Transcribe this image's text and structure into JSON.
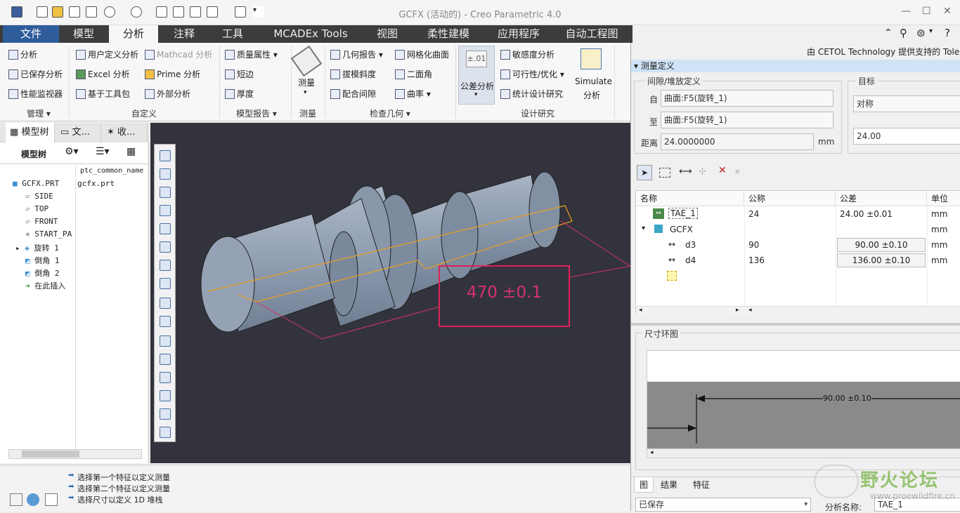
{
  "window": {
    "title": "GCFX (活动的) - Creo Parametric 4.0"
  },
  "tabs": [
    "文件",
    "模型",
    "分析",
    "注释",
    "工具",
    "MCADEx Tools",
    "视图",
    "柔性建模",
    "应用程序",
    "自动工程图"
  ],
  "ribbon": {
    "manage": {
      "items": [
        "分析",
        "已保存分析",
        "性能监视器"
      ],
      "group": "管理"
    },
    "custom": {
      "items": [
        "用户定义分析",
        "Mathcad 分析",
        "Excel 分析",
        "Prime 分析",
        "基于工具包",
        "外部分析"
      ],
      "group": "自定义"
    },
    "model_report": {
      "items": [
        "质量属性",
        "短边",
        "厚度"
      ],
      "group": "模型报告"
    },
    "measure": {
      "label": "测量",
      "group": "测量"
    },
    "inspect": {
      "items": [
        "几何报告",
        "网格化曲面",
        "拔模斜度",
        "二面角",
        "配合间隙",
        "曲率"
      ],
      "group": "检查几何"
    },
    "design": {
      "tol_icon": "±.01",
      "tol_label": "公差分析",
      "items": [
        "敏感度分析",
        "可行性/优化",
        "统计设计研究"
      ],
      "simulate": [
        "Simulate",
        "分析"
      ],
      "group": "设计研究"
    }
  },
  "sidebar": {
    "tabs": [
      "模型树",
      "文...",
      "收..."
    ],
    "toolbar_label": "模型树",
    "column": "ptc_common_name",
    "items": [
      {
        "label": "GCFX.PRT",
        "value": "gcfx.prt"
      },
      {
        "label": "SIDE"
      },
      {
        "label": "TOP"
      },
      {
        "label": "FRONT"
      },
      {
        "label": "START_PA"
      },
      {
        "label": "旋转 1"
      },
      {
        "label": "倒角 1"
      },
      {
        "label": "倒角 2"
      },
      {
        "label": "在此插入"
      }
    ]
  },
  "viewport": {
    "dimension_text": "470 ±0.1"
  },
  "status": {
    "messages": [
      "选择第一个特征以定义测量",
      "选择第二个特征以定义测量",
      "选择尺寸以定义 1D 堆栈"
    ]
  },
  "panel": {
    "header": "由 CETOL Technology 提供支持的 Toler",
    "section": "测量定义",
    "gap_group": "间隙/堆放定义",
    "from_label": "自",
    "from_value": "曲面:F5(旋转_1)",
    "to_label": "至",
    "to_value": "曲面:F5(旋转_1)",
    "dist_label": "距离",
    "dist_value": "24.0000000",
    "dist_unit": "mm",
    "target_group": "目标",
    "target_select": "对称",
    "target_value": "24.00",
    "table": {
      "headers": [
        "名称",
        "公称",
        "公差",
        "单位"
      ],
      "rows": [
        {
          "name": "TAE_1",
          "nominal": "24",
          "tol": "24.00 ±0.01",
          "unit": "mm"
        },
        {
          "name": "GCFX",
          "nominal": "",
          "tol": "",
          "unit": "mm"
        },
        {
          "name": "d3",
          "nominal": "90",
          "tol": "90.00 ±0.10",
          "unit": "mm"
        },
        {
          "name": "d4",
          "nominal": "136",
          "tol": "136.00 ±0.10",
          "unit": "mm"
        }
      ]
    },
    "loop_title": "尺寸环图",
    "loop_dim": "90.00 ±0.10",
    "bottom_tabs": [
      "图",
      "结果",
      "特征"
    ],
    "saved_select": "已保存",
    "analysis_name_label": "分析名称:",
    "analysis_name": "TAE_1"
  },
  "watermark": {
    "text": "野火论坛",
    "url": "www.proewildfire.cn"
  },
  "colors": {
    "file_tab": "#2f5d9c",
    "viewport_bg": "#33333d",
    "dimension": "#d4336b",
    "section_header": "#cfe3f7"
  }
}
